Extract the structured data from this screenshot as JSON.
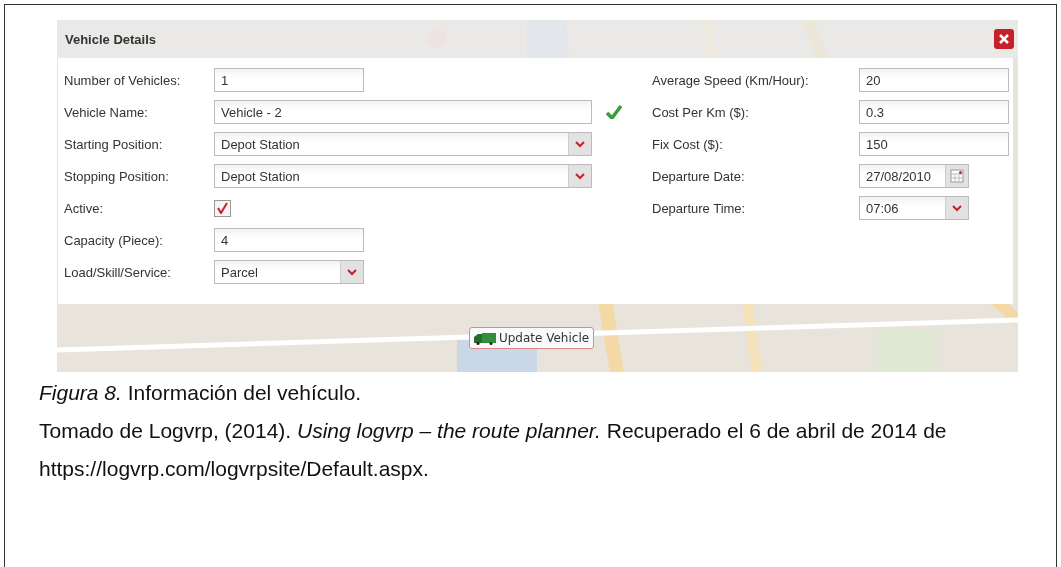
{
  "dialog": {
    "title": "Vehicle Details",
    "left_fields": [
      {
        "kind": "text",
        "label": "Number of Vehicles:",
        "value": "1"
      },
      {
        "kind": "longtext",
        "label": "Vehicle Name:",
        "value": "Vehicle - 2",
        "valid": true
      },
      {
        "kind": "longselect",
        "label": "Starting Position:",
        "value": "Depot Station"
      },
      {
        "kind": "longselect",
        "label": "Stopping Position:",
        "value": "Depot Station"
      },
      {
        "kind": "checkbox",
        "label": "Active:",
        "checked": true
      },
      {
        "kind": "text",
        "label": "Capacity (Piece):",
        "value": "4"
      },
      {
        "kind": "select",
        "label": "Load/Skill/Service:",
        "value": "Parcel"
      }
    ],
    "right_fields": [
      {
        "kind": "text",
        "label": "Average Speed (Km/Hour):",
        "value": "20"
      },
      {
        "kind": "text",
        "label": "Cost Per Km ($):",
        "value": "0.3"
      },
      {
        "kind": "text",
        "label": "Fix Cost ($):",
        "value": "150"
      },
      {
        "kind": "date",
        "label": "Departure Date:",
        "value": "27/08/2010"
      },
      {
        "kind": "select",
        "label": "Departure Time:",
        "value": "07:06"
      }
    ],
    "button": "Update Vehicle"
  },
  "caption": "*Figura 8.* Información del vehículo.",
  "citation": "Tomado de Logvrp, (2014). *Using logvrp – the route planner.* Recuperado el 6 de abril de 2014 de https://logvrp.com/logvrpsite/Default.aspx."
}
